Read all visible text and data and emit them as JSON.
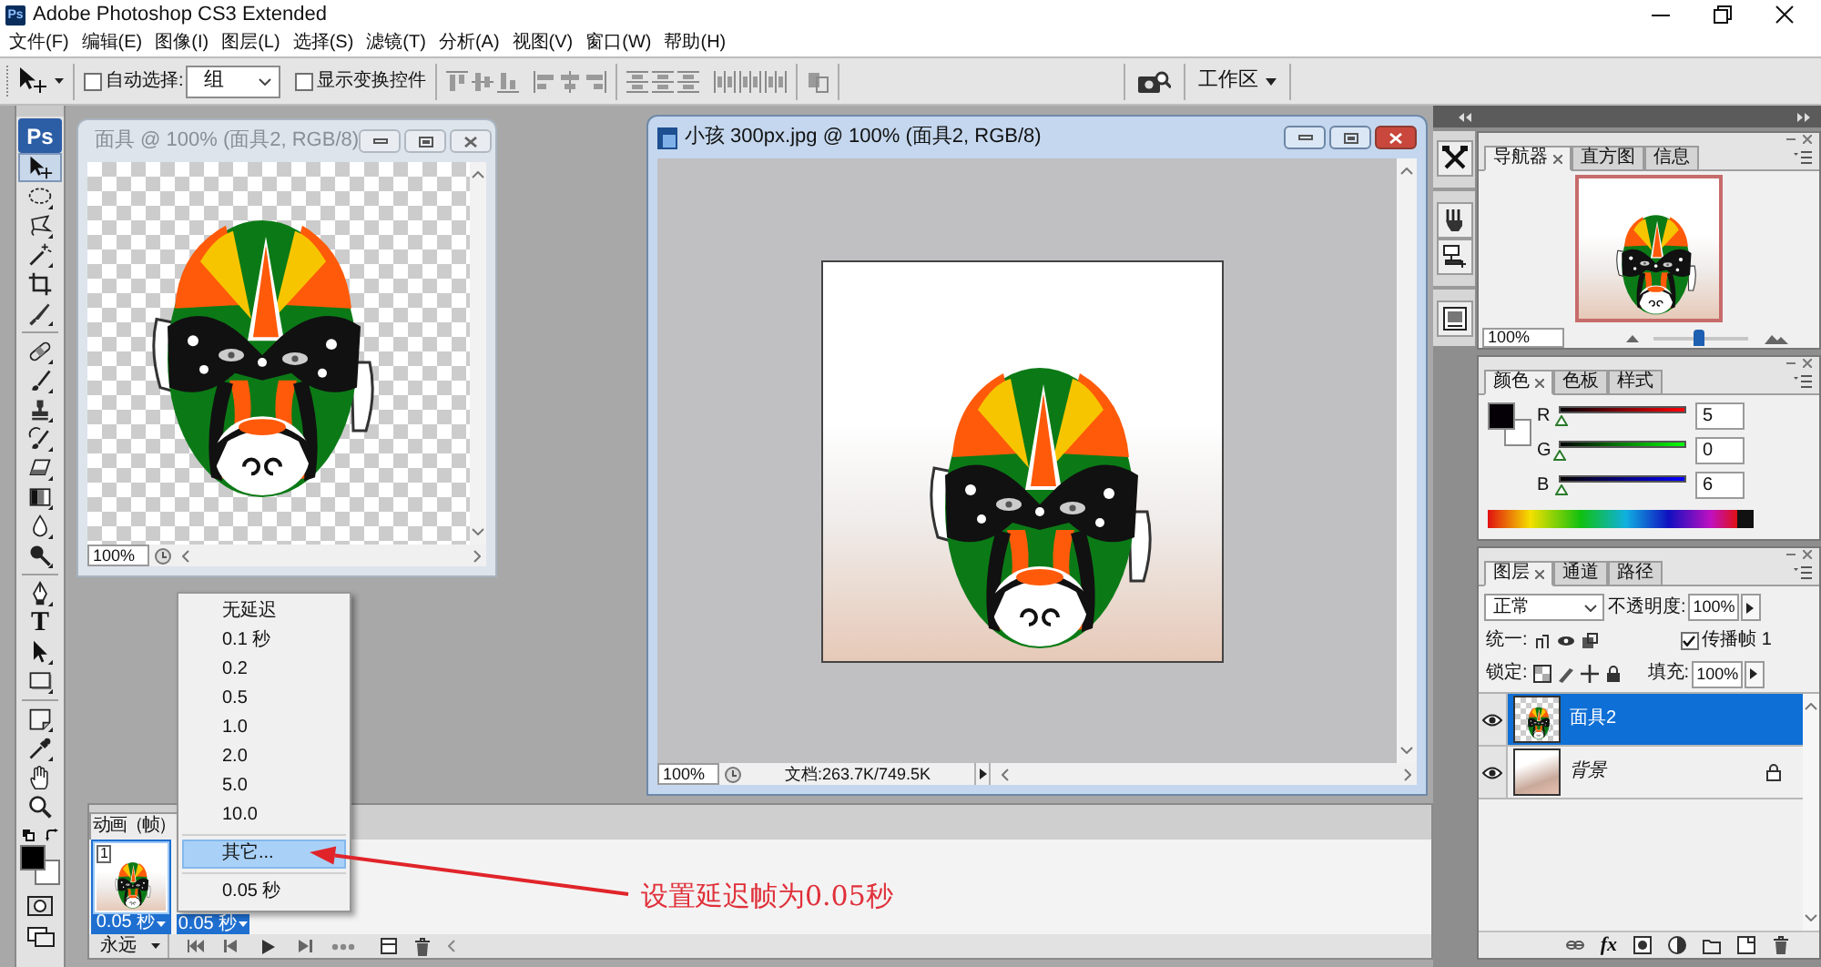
{
  "window": {
    "app_icon": "Ps",
    "title": "Adobe Photoshop CS3 Extended"
  },
  "menu_bar": [
    "文件(F)",
    "编辑(E)",
    "图像(I)",
    "图层(L)",
    "选择(S)",
    "滤镜(T)",
    "分析(A)",
    "视图(V)",
    "窗口(W)",
    "帮助(H)"
  ],
  "options_bar": {
    "auto_select": {
      "label": "自动选择:",
      "checked": false
    },
    "auto_select_target": "组",
    "show_transform_controls": {
      "label": "显示变换控件",
      "checked": false
    },
    "workspace_button": "工作区"
  },
  "toolbox": {
    "logo": "Ps",
    "tool_groups": [
      [
        {
          "kind": "move",
          "selected": true
        },
        {
          "kind": "marquee",
          "selected": false
        },
        {
          "kind": "lasso",
          "selected": false
        },
        {
          "kind": "magic_wand",
          "selected": false
        },
        {
          "kind": "crop",
          "selected": false
        },
        {
          "kind": "slice",
          "selected": false
        }
      ],
      [
        {
          "kind": "healing",
          "selected": false
        },
        {
          "kind": "brush",
          "selected": false
        },
        {
          "kind": "stamp",
          "selected": false
        },
        {
          "kind": "history_brush",
          "selected": false
        },
        {
          "kind": "eraser",
          "selected": false
        },
        {
          "kind": "gradient",
          "selected": false
        },
        {
          "kind": "blur",
          "selected": false
        },
        {
          "kind": "dodge",
          "selected": false
        }
      ],
      [
        {
          "kind": "pen",
          "selected": false
        },
        {
          "kind": "type",
          "label": "T",
          "selected": false
        },
        {
          "kind": "path_selection",
          "selected": false
        },
        {
          "kind": "shape",
          "selected": false
        }
      ],
      [
        {
          "kind": "notes",
          "selected": false
        },
        {
          "kind": "eyedropper",
          "selected": false
        },
        {
          "kind": "hand",
          "selected": false
        },
        {
          "kind": "zoom",
          "selected": false
        }
      ]
    ]
  },
  "documents": [
    {
      "kind": "transparent",
      "title": "面具 @ 100% (面具2, RGB/8)",
      "active": false,
      "zoom": "100%"
    },
    {
      "kind": "photo",
      "title": "小孩 300px.jpg @ 100% (面具2, RGB/8)",
      "active": true,
      "zoom": "100%",
      "info": "文档:263.7K/749.5K"
    }
  ],
  "animation_panel": {
    "tab": "动画（帧）",
    "frames": [
      {
        "number": "1",
        "delay": "0.05 秒",
        "selected": true
      },
      {
        "delay": "0.05 秒",
        "selected": true
      }
    ],
    "loop": "永远"
  },
  "delay_menu": {
    "groups": [
      [
        {
          "label": "无延迟",
          "selected": false
        },
        {
          "label": "0.1 秒",
          "selected": false
        },
        {
          "label": "0.2",
          "selected": false
        },
        {
          "label": "0.5",
          "selected": false
        },
        {
          "label": "1.0",
          "selected": false
        },
        {
          "label": "2.0",
          "selected": false
        },
        {
          "label": "5.0",
          "selected": false
        },
        {
          "label": "10.0",
          "selected": false
        }
      ],
      [
        {
          "label": "其它...",
          "selected": true
        }
      ],
      [
        {
          "label": "0.05 秒",
          "selected": false
        }
      ]
    ]
  },
  "annotation": {
    "text": "设置延迟帧为0.05秒"
  },
  "navigator_panel": {
    "tabs": [
      {
        "label": "导航器",
        "selected": true
      },
      {
        "label": "直方图",
        "selected": false
      },
      {
        "label": "信息",
        "selected": false
      }
    ],
    "zoom": "100%",
    "level": 0.48
  },
  "color_panel": {
    "tabs": [
      {
        "label": "颜色",
        "selected": true
      },
      {
        "label": "色板",
        "selected": false
      },
      {
        "label": "样式",
        "selected": false
      }
    ],
    "channels": [
      {
        "name": "R",
        "value": "5",
        "level": 0.02
      },
      {
        "name": "G",
        "value": "0",
        "level": 0
      },
      {
        "name": "B",
        "value": "6",
        "level": 0.02
      }
    ]
  },
  "layers_panel": {
    "tabs": [
      {
        "label": "图层",
        "selected": true
      },
      {
        "label": "通道",
        "selected": false
      },
      {
        "label": "路径",
        "selected": false
      }
    ],
    "blend_mode": "正常",
    "opacity_label": "不透明度:",
    "opacity": "100%",
    "unify_label": "统一:",
    "propagate_frame": {
      "label": "传播帧 1",
      "checked": true
    },
    "lock_label": "锁定:",
    "fill_label": "填充:",
    "fill": "100%",
    "layers": [
      {
        "kind": "layer",
        "name": "面具2",
        "selected": true,
        "visible": true,
        "locked": false
      },
      {
        "kind": "background",
        "name": "背景",
        "selected": false,
        "visible": true,
        "locked": true
      }
    ],
    "style_button": "fx"
  }
}
